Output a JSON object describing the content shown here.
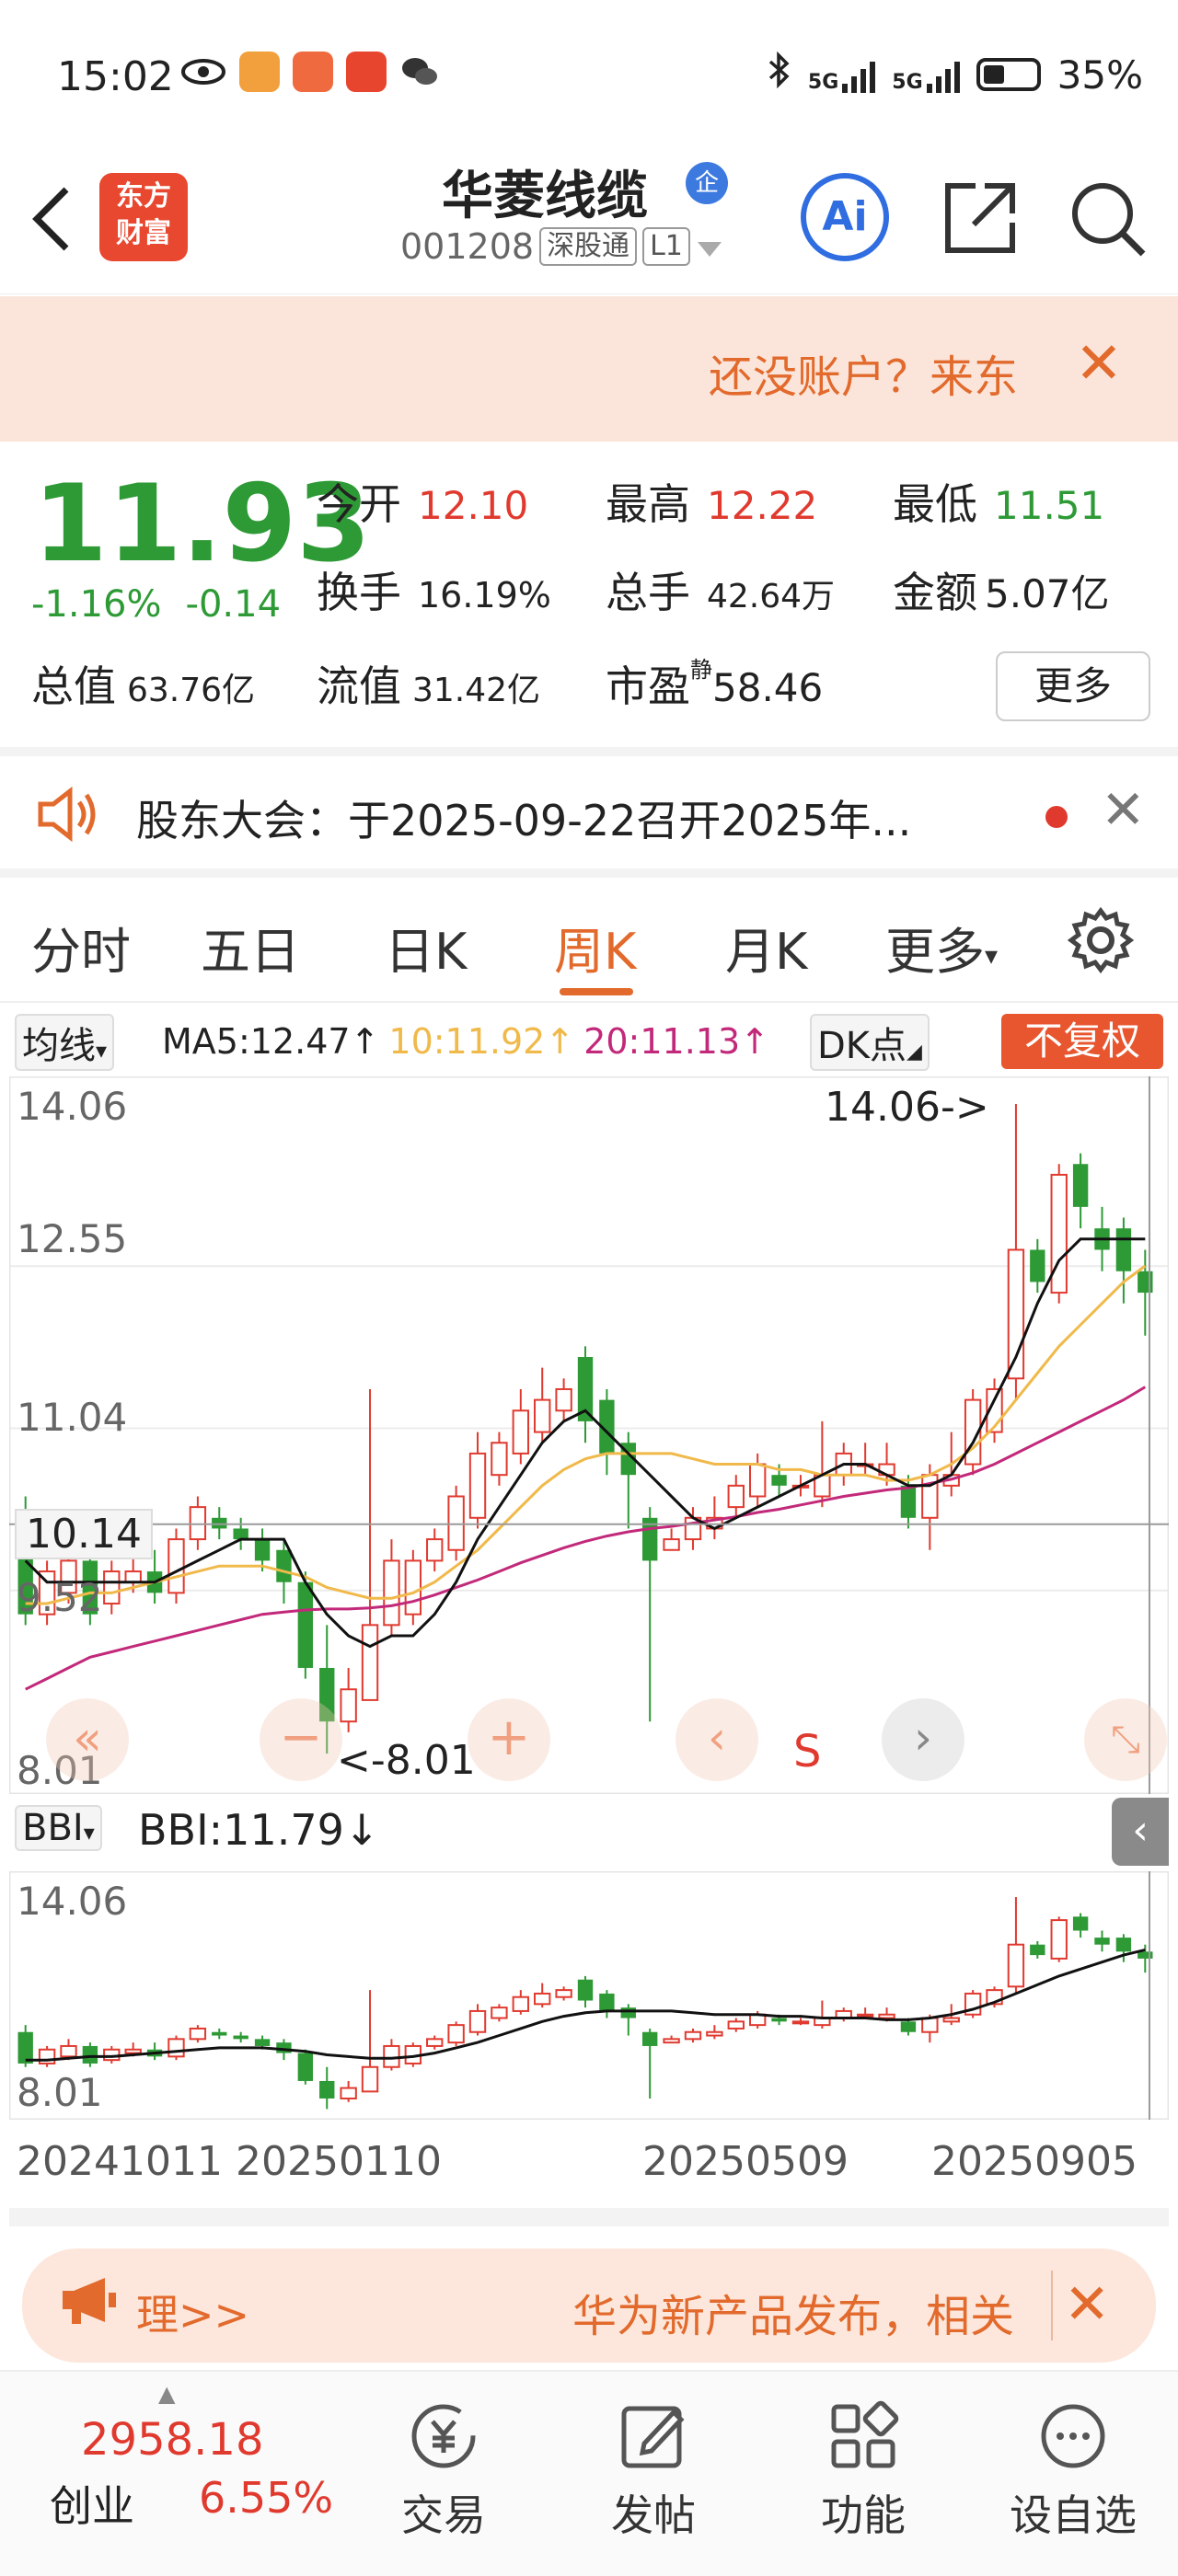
{
  "status_bar": {
    "time": "15:02",
    "signal1": "5G",
    "signal2": "5G",
    "battery": "35%"
  },
  "header": {
    "stock_name": "华菱线缆",
    "badge": "企",
    "code": "001208",
    "market": "深股通",
    "level": "L1",
    "logo_line1": "东方",
    "logo_line2": "财富",
    "ai_label": "Ai"
  },
  "banner": {
    "text": "还没账户？来东",
    "close": "✕"
  },
  "quote": {
    "price": "11.93",
    "change_pct": "-1.16%",
    "change": "-0.14",
    "open_label": "今开",
    "open": "12.10",
    "high_label": "最高",
    "high": "12.22",
    "low_label": "最低",
    "low": "11.51",
    "turnover_label": "换手",
    "turnover": "16.19%",
    "volume_label": "总手",
    "volume": "42.64万",
    "amount_label": "金额",
    "amount": "5.07亿",
    "mktcap_label": "总值",
    "mktcap": "63.76亿",
    "float_label": "流值",
    "float": "31.42亿",
    "pe_label": "市盈",
    "pe_sup": "静",
    "pe": "58.46",
    "more": "更多"
  },
  "notice": {
    "text": "股东大会：于2025-09-22召开2025年...",
    "close": "✕"
  },
  "tabs": {
    "items": [
      "分时",
      "五日",
      "日K",
      "周K",
      "月K",
      "更多"
    ],
    "active": "周K"
  },
  "ma_legend": {
    "selector": "均线",
    "ma5": "MA5:12.47↑",
    "ma10": "10:11.92↑",
    "ma20": "20:11.13↑",
    "dk": "DK点",
    "adjust": "不复权"
  },
  "chart_data": {
    "type": "candlestick",
    "y_labels": [
      "14.06",
      "12.55",
      "11.04",
      "9.52",
      "8.01"
    ],
    "crosshair_value": "10.14",
    "max_marker": "14.06->",
    "min_marker": "<-8.01",
    "x_labels": [
      "20241011",
      "20250110",
      "20250509",
      "20250905"
    ],
    "ylim": [
      8.01,
      14.06
    ],
    "candles": [
      [
        10.2,
        9.3,
        10.4,
        9.2
      ],
      [
        9.3,
        9.7,
        9.8,
        9.2
      ],
      [
        9.5,
        9.8,
        10.0,
        9.4
      ],
      [
        9.8,
        9.3,
        9.9,
        9.2
      ],
      [
        9.4,
        9.7,
        9.8,
        9.3
      ],
      [
        9.6,
        9.7,
        9.9,
        9.5
      ],
      [
        9.7,
        9.5,
        9.9,
        9.4
      ],
      [
        9.5,
        10.0,
        10.1,
        9.4
      ],
      [
        10.0,
        10.3,
        10.4,
        9.9
      ],
      [
        10.2,
        10.1,
        10.3,
        10.0
      ],
      [
        10.1,
        10.0,
        10.2,
        9.9
      ],
      [
        10.0,
        9.8,
        10.1,
        9.7
      ],
      [
        9.9,
        9.6,
        10.0,
        9.4
      ],
      [
        9.6,
        8.8,
        9.7,
        8.7
      ],
      [
        8.8,
        8.3,
        9.2,
        8.0
      ],
      [
        8.3,
        8.6,
        8.8,
        8.2
      ],
      [
        8.5,
        9.2,
        11.4,
        8.5
      ],
      [
        9.2,
        9.8,
        10.0,
        9.1
      ],
      [
        9.3,
        9.8,
        9.9,
        9.2
      ],
      [
        9.8,
        10.0,
        10.1,
        9.7
      ],
      [
        9.9,
        10.4,
        10.5,
        9.8
      ],
      [
        10.2,
        10.8,
        11.0,
        10.1
      ],
      [
        10.6,
        10.9,
        11.0,
        10.5
      ],
      [
        10.8,
        11.2,
        11.4,
        10.7
      ],
      [
        11.0,
        11.3,
        11.6,
        10.9
      ],
      [
        11.2,
        11.4,
        11.5,
        11.1
      ],
      [
        11.7,
        11.1,
        11.8,
        10.9
      ],
      [
        11.3,
        10.8,
        11.4,
        10.6
      ],
      [
        10.9,
        10.6,
        11.0,
        10.1
      ],
      [
        10.2,
        9.8,
        10.3,
        8.3
      ],
      [
        9.9,
        10.0,
        10.1,
        9.9
      ],
      [
        10.0,
        10.2,
        10.3,
        9.9
      ],
      [
        10.1,
        10.2,
        10.4,
        10.0
      ],
      [
        10.3,
        10.5,
        10.6,
        10.2
      ],
      [
        10.4,
        10.7,
        10.8,
        10.3
      ],
      [
        10.6,
        10.5,
        10.7,
        10.4
      ],
      [
        10.5,
        10.5,
        10.6,
        10.4
      ],
      [
        10.4,
        10.6,
        11.1,
        10.3
      ],
      [
        10.6,
        10.8,
        10.9,
        10.5
      ],
      [
        10.7,
        10.7,
        10.9,
        10.6
      ],
      [
        10.6,
        10.7,
        10.9,
        10.5
      ],
      [
        10.5,
        10.2,
        10.6,
        10.1
      ],
      [
        10.2,
        10.6,
        10.7,
        9.9
      ],
      [
        10.5,
        10.6,
        11.0,
        10.4
      ],
      [
        10.7,
        11.3,
        11.4,
        10.6
      ],
      [
        11.0,
        11.4,
        11.5,
        10.9
      ],
      [
        11.5,
        12.7,
        14.06,
        11.3
      ],
      [
        12.7,
        12.4,
        12.8,
        12.3
      ],
      [
        12.3,
        13.4,
        13.5,
        12.2
      ],
      [
        13.5,
        13.1,
        13.6,
        12.9
      ],
      [
        12.9,
        12.7,
        13.1,
        12.5
      ],
      [
        12.9,
        12.5,
        13.0,
        12.2
      ],
      [
        12.5,
        12.3,
        12.7,
        11.9
      ]
    ],
    "ma5": [
      9.8,
      9.6,
      9.6,
      9.6,
      9.6,
      9.6,
      9.6,
      9.7,
      9.8,
      9.9,
      10.0,
      10.0,
      10.0,
      9.6,
      9.3,
      9.1,
      9.0,
      9.1,
      9.1,
      9.3,
      9.6,
      10.0,
      10.3,
      10.6,
      10.9,
      11.1,
      11.2,
      11.0,
      10.8,
      10.6,
      10.4,
      10.2,
      10.1,
      10.2,
      10.3,
      10.4,
      10.5,
      10.6,
      10.7,
      10.7,
      10.6,
      10.5,
      10.5,
      10.6,
      10.9,
      11.3,
      11.7,
      12.2,
      12.6,
      12.8,
      12.8,
      12.8,
      12.8
    ],
    "ma10": [
      9.4,
      9.4,
      9.45,
      9.5,
      9.5,
      9.55,
      9.6,
      9.65,
      9.7,
      9.75,
      9.75,
      9.75,
      9.7,
      9.65,
      9.55,
      9.5,
      9.45,
      9.45,
      9.5,
      9.6,
      9.75,
      9.9,
      10.1,
      10.3,
      10.5,
      10.65,
      10.75,
      10.8,
      10.8,
      10.8,
      10.8,
      10.75,
      10.7,
      10.7,
      10.7,
      10.65,
      10.65,
      10.6,
      10.6,
      10.6,
      10.55,
      10.55,
      10.6,
      10.7,
      10.85,
      11.05,
      11.3,
      11.55,
      11.8,
      12.0,
      12.2,
      12.4,
      12.55
    ],
    "ma20": [
      8.6,
      8.7,
      8.8,
      8.9,
      8.95,
      9.0,
      9.05,
      9.1,
      9.15,
      9.2,
      9.25,
      9.3,
      9.32,
      9.34,
      9.35,
      9.35,
      9.36,
      9.38,
      9.42,
      9.48,
      9.55,
      9.62,
      9.7,
      9.78,
      9.85,
      9.92,
      9.98,
      10.03,
      10.07,
      10.1,
      10.12,
      10.15,
      10.18,
      10.21,
      10.25,
      10.28,
      10.32,
      10.36,
      10.4,
      10.43,
      10.46,
      10.48,
      10.52,
      10.56,
      10.62,
      10.7,
      10.8,
      10.9,
      11.0,
      11.1,
      11.2,
      11.3,
      11.42
    ]
  },
  "bbi_bar": {
    "selector": "BBI",
    "value": "BBI:11.79↓"
  },
  "sub_chart": {
    "y_labels": [
      "14.06",
      "8.01"
    ]
  },
  "ad": {
    "left": "理>>",
    "right": "华为新产品发布，相关",
    "close": "✕"
  },
  "bottom_nav": {
    "index_value": "2958.18",
    "index_name": "创业",
    "index_pct": "6.55%",
    "items": [
      "交易",
      "发帖",
      "功能",
      "设自选"
    ]
  },
  "colors": {
    "up": "#e03a2f",
    "down": "#2e9a36",
    "accent": "#e26a2c",
    "ma5": "#111111",
    "ma10": "#f0b94a",
    "ma20": "#c2297a"
  }
}
